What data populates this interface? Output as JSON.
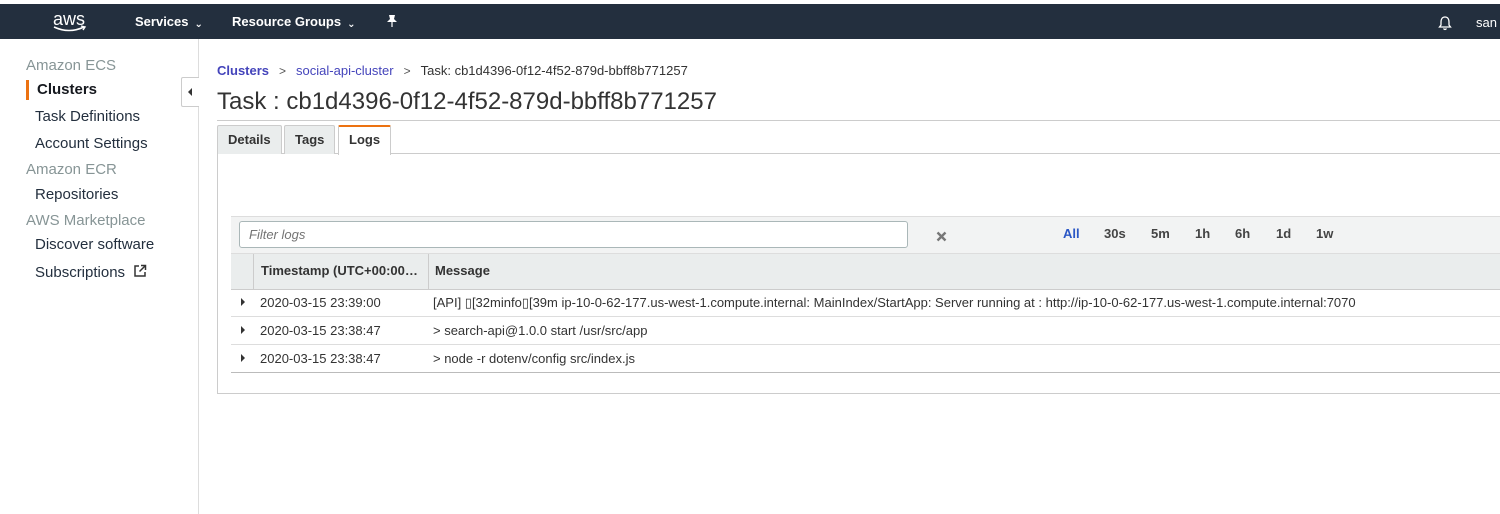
{
  "topnav": {
    "logo": "aws",
    "services": "Services",
    "resource_groups": "Resource Groups",
    "user": "san"
  },
  "sidebar": {
    "groups": [
      {
        "title": "Amazon ECS",
        "items": [
          "Clusters",
          "Task Definitions",
          "Account Settings"
        ]
      },
      {
        "title": "Amazon ECR",
        "items": [
          "Repositories"
        ]
      },
      {
        "title": "AWS Marketplace",
        "items": [
          "Discover software",
          "Subscriptions"
        ]
      }
    ],
    "active_item": "Clusters"
  },
  "breadcrumb": {
    "items": [
      "Clusters",
      "social-api-cluster",
      "Task: cb1d4396-0f12-4f52-879d-bbff8b771257"
    ],
    "separator": ">"
  },
  "page_title": "Task : cb1d4396-0f12-4f52-879d-bbff8b771257",
  "tabs": [
    "Details",
    "Tags",
    "Logs"
  ],
  "active_tab": "Logs",
  "logs": {
    "filter_placeholder": "Filter logs",
    "time_ranges": [
      "All",
      "30s",
      "5m",
      "1h",
      "6h",
      "1d",
      "1w"
    ],
    "selected_range": "All",
    "columns": [
      "Timestamp (UTC+00:00…",
      "Message"
    ],
    "rows": [
      {
        "timestamp": "2020-03-15 23:39:00",
        "message": "[API] \u0000[32minfo\u0000[39m ip-10-0-62-177.us-west-1.compute.internal: MainIndex/StartApp: Server running at : http://ip-10-0-62-177.us-west-1.compute.internal:7070"
      },
      {
        "timestamp": "2020-03-15 23:38:47",
        "message": "> search-api@1.0.0 start /usr/src/app"
      },
      {
        "timestamp": "2020-03-15 23:38:47",
        "message": "> node -r dotenv/config src/index.js"
      }
    ]
  },
  "colors": {
    "nav_bg": "#232f3e",
    "accent": "#ec7211",
    "link": "#44b",
    "selected_range": "#2b57c5"
  }
}
